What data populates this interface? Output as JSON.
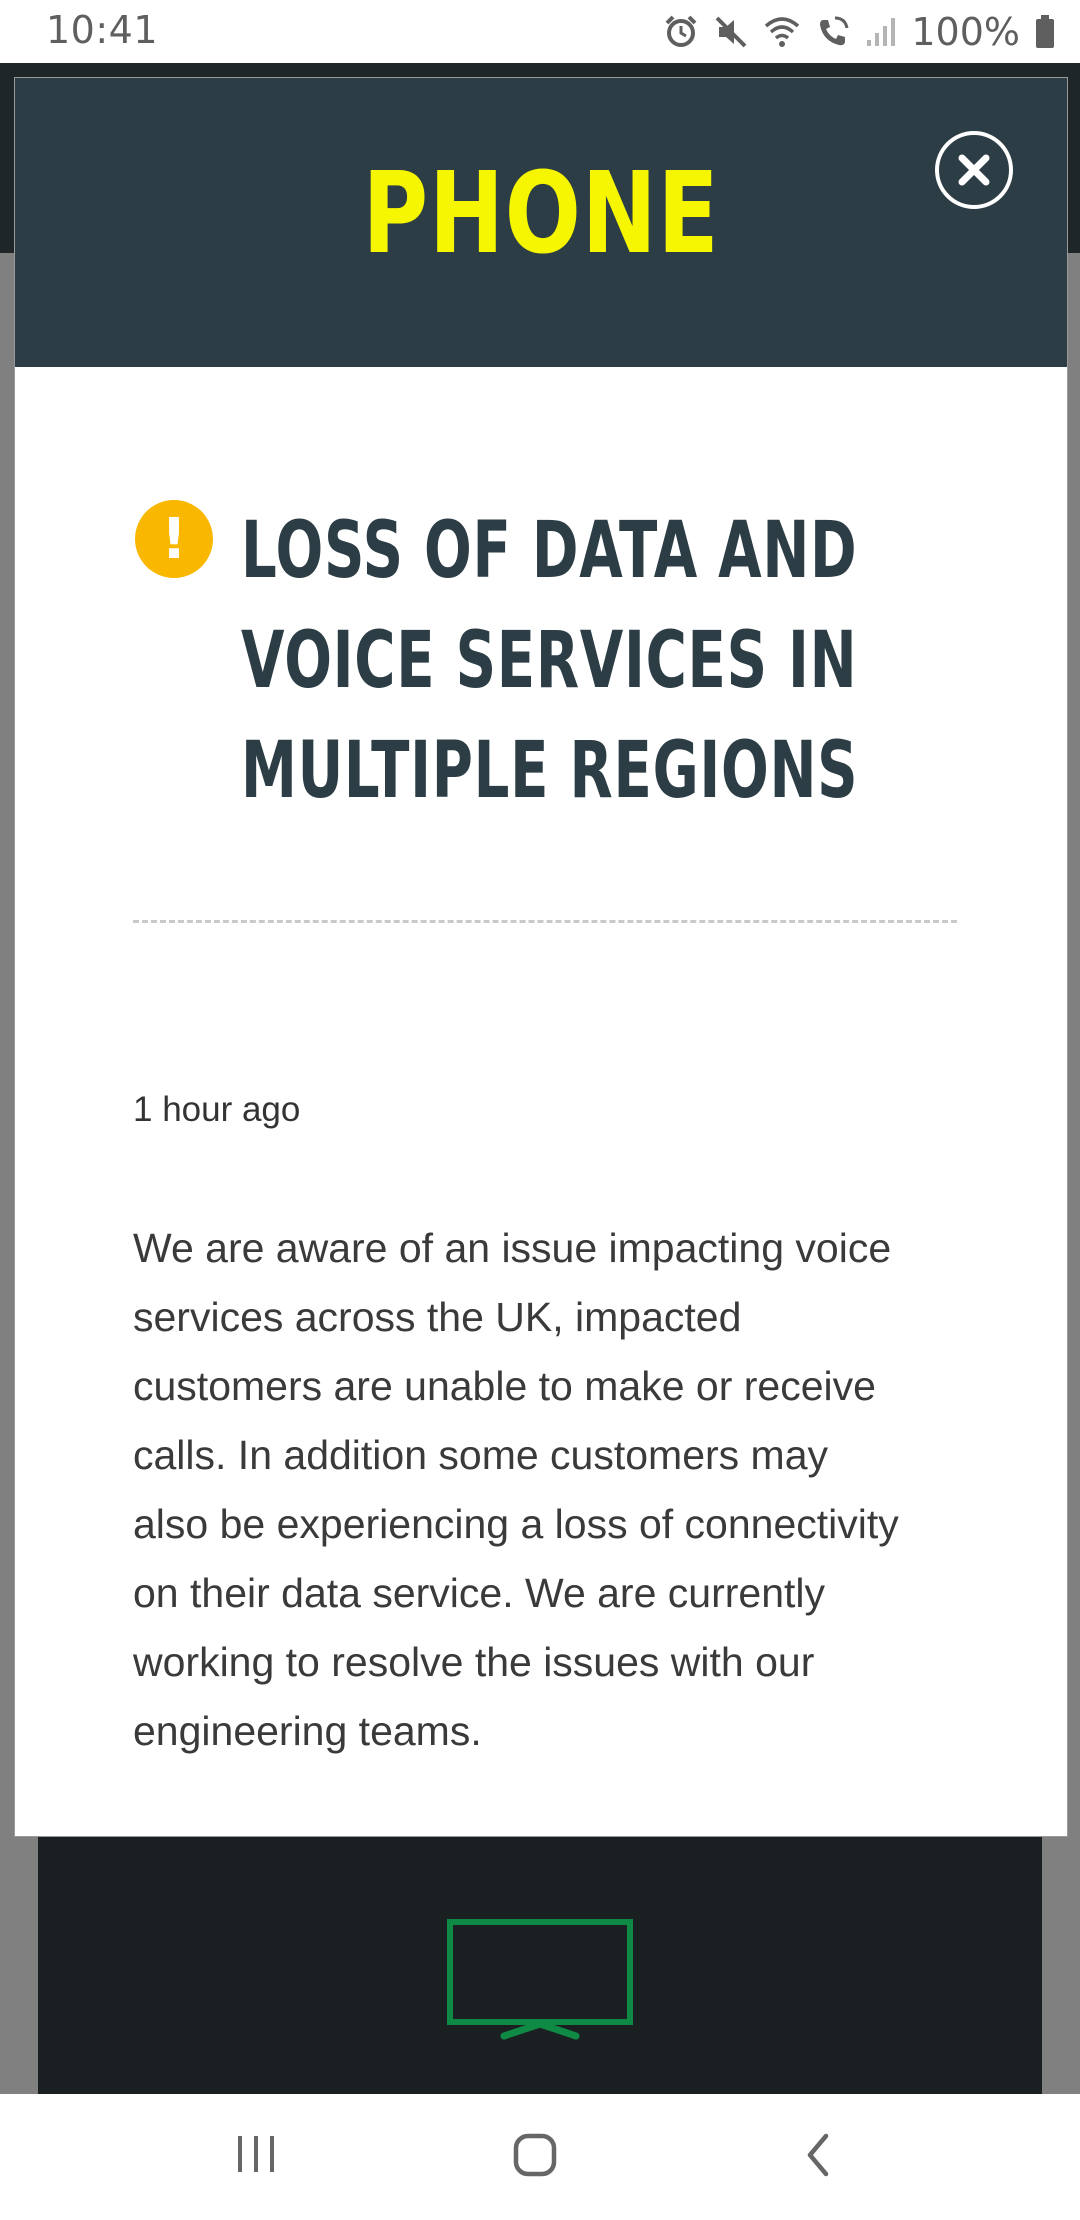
{
  "status_bar": {
    "time": "10:41",
    "battery": "100%",
    "icons": [
      "alarm-icon",
      "mute-icon",
      "wifi-icon",
      "wifi-calling-icon",
      "signal-icon",
      "battery-icon"
    ]
  },
  "modal": {
    "title": "PHONE",
    "close_icon": "close-icon",
    "alert_symbol": "!",
    "incident_title_lines": [
      "LOSS OF DATA AND",
      "VOICE SERVICES IN",
      "MULTIPLE REGIONS"
    ],
    "timestamp": "1 hour ago",
    "body_lines": [
      "We are aware of an issue impacting voice",
      "services across the UK, impacted",
      "customers are unable to make or receive",
      "calls. In addition some customers may",
      "also be experiencing a loss of connectivity",
      "on their data service. We are currently",
      "working to resolve the issues with our",
      "engineering teams."
    ]
  },
  "background": {
    "icon": "tv-icon"
  },
  "nav_bar": {
    "icons": [
      "recent-apps-icon",
      "home-icon",
      "back-icon"
    ]
  },
  "colors": {
    "header_bg": "#2c3d45",
    "title_yellow": "#f6f600",
    "alert_amber": "#f9b700",
    "tv_green": "#0f8a45"
  }
}
